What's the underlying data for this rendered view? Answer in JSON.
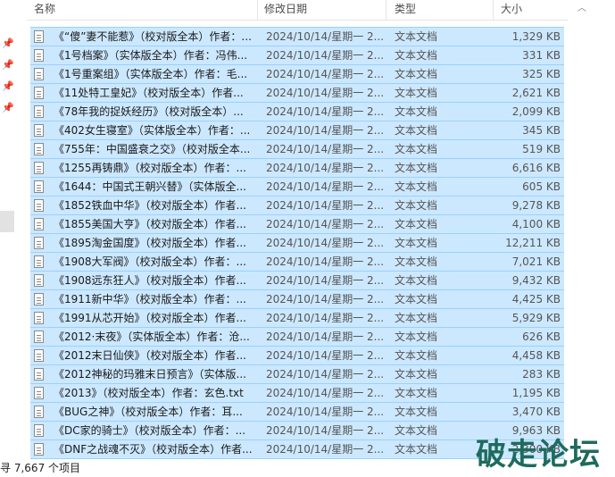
{
  "columns": {
    "name": "名称",
    "date": "修改日期",
    "type": "类型",
    "size": "大小"
  },
  "files": [
    {
      "name": "《“傻”妻不能惹》（校对版全本）作者：...",
      "date": "2024/10/14/星期一 2...",
      "type": "文本文档",
      "size": "1,329 KB"
    },
    {
      "name": "《1号档案》（实体版全本）作者：冯伟...",
      "date": "2024/10/14/星期一 2...",
      "type": "文本文档",
      "size": "331 KB"
    },
    {
      "name": "《1号重案组》（实体版全本）作者：毛...",
      "date": "2024/10/14/星期一 2...",
      "type": "文本文档",
      "size": "325 KB"
    },
    {
      "name": "《11处特工皇妃》（校对版全本）作者...",
      "date": "2024/10/14/星期一 2...",
      "type": "文本文档",
      "size": "2,621 KB"
    },
    {
      "name": "《78年我的捉妖经历》（校对版全本）...",
      "date": "2024/10/14/星期一 2...",
      "type": "文本文档",
      "size": "2,099 KB"
    },
    {
      "name": "《402女生寝室》（实体版全本）作者：...",
      "date": "2024/10/14/星期一 2...",
      "type": "文本文档",
      "size": "345 KB"
    },
    {
      "name": "《755年：中国盛衰之交》（校对版全本...",
      "date": "2024/10/14/星期一 2...",
      "type": "文本文档",
      "size": "519 KB"
    },
    {
      "name": "《1255再铸鼎》（校对版全本）作者：...",
      "date": "2024/10/14/星期一 2...",
      "type": "文本文档",
      "size": "6,616 KB"
    },
    {
      "name": "《1644：中国式王朝兴替》（实体版全...",
      "date": "2024/10/14/星期一 2...",
      "type": "文本文档",
      "size": "605 KB"
    },
    {
      "name": "《1852铁血中华》（校对版全本）作者...",
      "date": "2024/10/14/星期一 2...",
      "type": "文本文档",
      "size": "9,278 KB"
    },
    {
      "name": "《1855美国大亨》（校对版全本）作者...",
      "date": "2024/10/14/星期一 2...",
      "type": "文本文档",
      "size": "4,100 KB"
    },
    {
      "name": "《1895淘金国度》（校对版全本）作者...",
      "date": "2024/10/14/星期一 2...",
      "type": "文本文档",
      "size": "12,211 KB"
    },
    {
      "name": "《1908大军阀》（校对版全本）作者：...",
      "date": "2024/10/14/星期一 2...",
      "type": "文本文档",
      "size": "7,021 KB"
    },
    {
      "name": "《1908远东狂人》（校对版全本）作者...",
      "date": "2024/10/14/星期一 2...",
      "type": "文本文档",
      "size": "9,432 KB"
    },
    {
      "name": "《1911新中华》（校对版全本）作者：...",
      "date": "2024/10/14/星期一 2...",
      "type": "文本文档",
      "size": "4,425 KB"
    },
    {
      "name": "《1991从芯开始》（校对版全本）作者...",
      "date": "2024/10/14/星期一 2...",
      "type": "文本文档",
      "size": "5,929 KB"
    },
    {
      "name": "《2012·末夜》（实体版全本）作者：沧...",
      "date": "2024/10/14/星期一 2...",
      "type": "文本文档",
      "size": "626 KB"
    },
    {
      "name": "《2012末日仙侠》（校对版全本）作者...",
      "date": "2024/10/14/星期一 2...",
      "type": "文本文档",
      "size": "4,458 KB"
    },
    {
      "name": "《2012神秘的玛雅末日预言》（实体版...",
      "date": "2024/10/14/星期一 2...",
      "type": "文本文档",
      "size": "283 KB"
    },
    {
      "name": "《2013》（校对版全本）作者：玄色.txt",
      "date": "2024/10/14/星期一 2...",
      "type": "文本文档",
      "size": "1,195 KB"
    },
    {
      "name": "《BUG之神》（校对版全本）作者：耳...",
      "date": "2024/10/14/星期一 2...",
      "type": "文本文档",
      "size": "3,470 KB"
    },
    {
      "name": "《DC家的骑士》（校对版全本）作者：...",
      "date": "2024/10/14/星期一 2...",
      "type": "文本文档",
      "size": "9,963 KB"
    },
    {
      "name": "《DNF之战魂不灭》（校对版全本）作者...",
      "date": "2024/10/14/星期一 2...",
      "type": "文本文档",
      "size": "2,300 KB"
    }
  ],
  "status": {
    "count_text": "7,667 个项目",
    "prefix": "寻"
  },
  "watermark": "破走论坛",
  "colors": {
    "selection_bg": "#cce8ff",
    "selection_border": "#99d1ff",
    "watermark": "#1e6b5d"
  },
  "icons": {
    "pin": "pin-icon",
    "file": "text-file-icon",
    "sort": "sort-arrow-up-icon"
  }
}
